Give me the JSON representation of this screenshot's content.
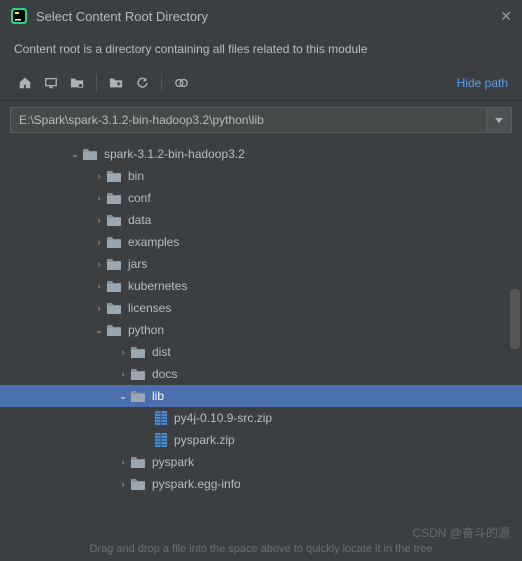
{
  "window": {
    "title": "Select Content Root Directory",
    "subtitle": "Content root is a directory containing all files related to this module"
  },
  "toolbar": {
    "hide_path": "Hide path"
  },
  "path_field": {
    "value": "E:\\Spark\\spark-3.1.2-bin-hadoop3.2\\python\\lib"
  },
  "tree": [
    {
      "depth": 0,
      "expanded": true,
      "kind": "folder",
      "label": "spark-3.1.2-bin-hadoop3.2",
      "selected": false
    },
    {
      "depth": 1,
      "expanded": false,
      "kind": "folder",
      "label": "bin",
      "selected": false
    },
    {
      "depth": 1,
      "expanded": false,
      "kind": "folder",
      "label": "conf",
      "selected": false
    },
    {
      "depth": 1,
      "expanded": false,
      "kind": "folder",
      "label": "data",
      "selected": false
    },
    {
      "depth": 1,
      "expanded": false,
      "kind": "folder",
      "label": "examples",
      "selected": false
    },
    {
      "depth": 1,
      "expanded": false,
      "kind": "folder",
      "label": "jars",
      "selected": false
    },
    {
      "depth": 1,
      "expanded": false,
      "kind": "folder",
      "label": "kubernetes",
      "selected": false
    },
    {
      "depth": 1,
      "expanded": false,
      "kind": "folder",
      "label": "licenses",
      "selected": false
    },
    {
      "depth": 1,
      "expanded": true,
      "kind": "folder",
      "label": "python",
      "selected": false
    },
    {
      "depth": 2,
      "expanded": false,
      "kind": "folder",
      "label": "dist",
      "selected": false
    },
    {
      "depth": 2,
      "expanded": false,
      "kind": "folder",
      "label": "docs",
      "selected": false
    },
    {
      "depth": 2,
      "expanded": true,
      "kind": "folder",
      "label": "lib",
      "selected": true
    },
    {
      "depth": 3,
      "expanded": null,
      "kind": "archive",
      "label": "py4j-0.10.9-src.zip",
      "selected": false
    },
    {
      "depth": 3,
      "expanded": null,
      "kind": "archive",
      "label": "pyspark.zip",
      "selected": false
    },
    {
      "depth": 2,
      "expanded": false,
      "kind": "folder",
      "label": "pyspark",
      "selected": false
    },
    {
      "depth": 2,
      "expanded": false,
      "kind": "folder",
      "label": "pyspark.egg-info",
      "selected": false
    }
  ],
  "hint": "Drag and drop a file into the space above to quickly locate it in the tree",
  "watermark": "CSDN @奋斗的源"
}
